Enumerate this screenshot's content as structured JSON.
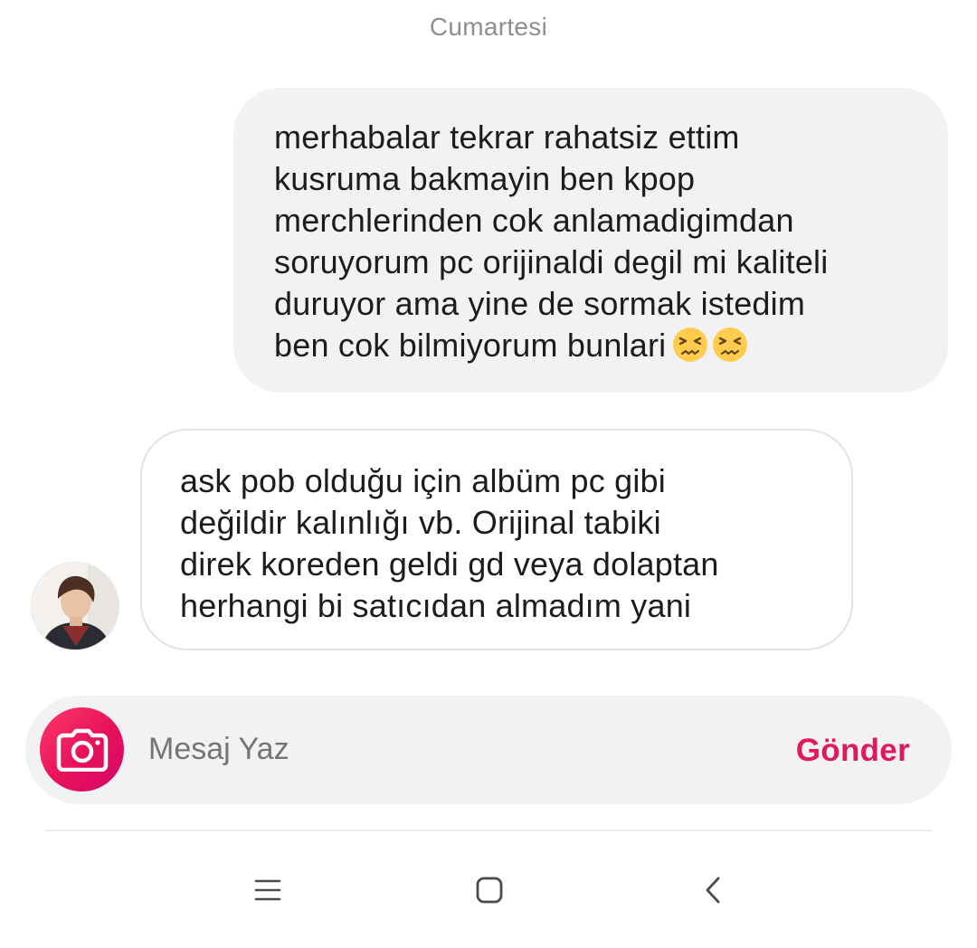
{
  "date_label": "Cumartesi",
  "messages": [
    {
      "direction": "outgoing",
      "text": "merhabalar tekrar rahatsiz ettim\nkusruma bakmayin ben kpop\nmerchlerinden cok anlamadigimdan\nsoruyorum pc orijinaldi degil mi kaliteli\nduruyor ama yine de sormak istedim\nben cok bilmiyorum bunlari",
      "emojis": [
        "persevering-face-emoji",
        "persevering-face-emoji"
      ]
    },
    {
      "direction": "incoming",
      "text": "ask pob olduğu için albüm pc gibi\ndeğildir kalınlığı vb. Orijinal tabiki\ndirek koreden geldi gd veya dolaptan\nherhangi bi satıcıdan almadım yani",
      "avatar": "user-avatar"
    }
  ],
  "composer": {
    "camera_icon": "camera-icon",
    "placeholder": "Mesaj Yaz",
    "send_label": "Gönder"
  },
  "nav": {
    "menu_icon": "menu-icon",
    "home_icon": "home-icon",
    "back_icon": "back-icon"
  },
  "colors": {
    "accent": "#e0185e",
    "outgoing_bubble": "#f2f2f4",
    "incoming_border": "#e3e3e6",
    "composer_bg": "#f2f2f4"
  }
}
